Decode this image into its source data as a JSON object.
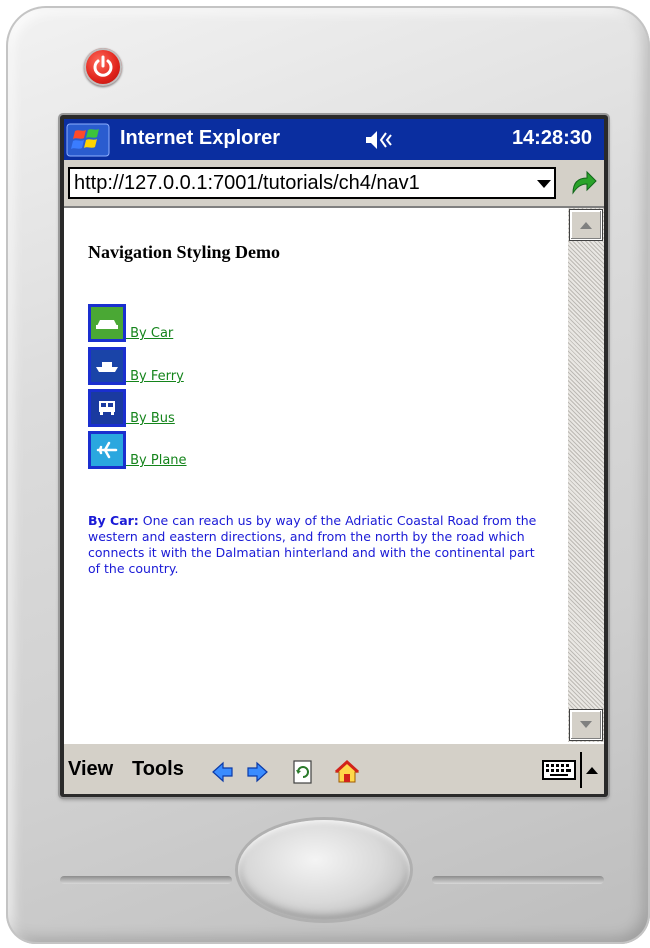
{
  "titlebar": {
    "app_title": "Internet Explorer",
    "clock": "14:28:30",
    "start_icon": "windows-flag-icon",
    "volume_icon": "speaker-icon"
  },
  "address": {
    "url": "http://127.0.0.1:7001/tutorials/ch4/nav1",
    "go_icon": "go-arrow-icon"
  },
  "page": {
    "heading": "Navigation Styling Demo",
    "nav_items": [
      {
        "label": " By Car",
        "icon": "car-icon"
      },
      {
        "label": " By Ferry",
        "icon": "ferry-icon"
      },
      {
        "label": " By Bus",
        "icon": "bus-icon"
      },
      {
        "label": " By Plane",
        "icon": "plane-icon"
      }
    ],
    "description_title": "By Car:",
    "description_body": " One can reach us by way of the Adriatic Coastal Road from the western and eastern directions, and from the north by the road which connects it with the Dalmatian hinterland and with the continental part of the country."
  },
  "cmdbar": {
    "view_label": "View",
    "tools_label": "Tools"
  },
  "colors": {
    "titlebar": "#0a2ea0",
    "link": "#14841b",
    "description_text": "#1a1ad6",
    "icon_border": "#1a2fcf",
    "power_button": "#e0231b"
  }
}
